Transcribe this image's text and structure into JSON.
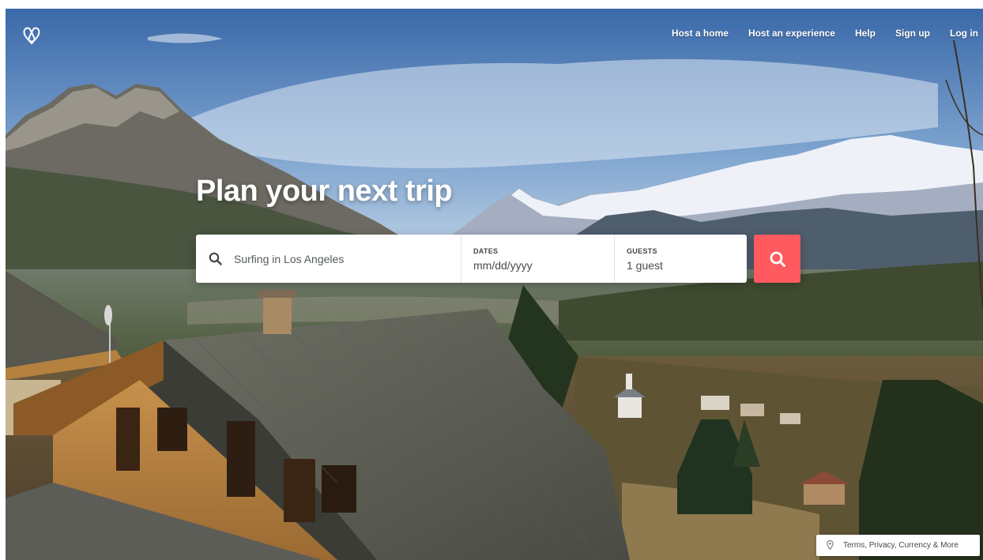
{
  "nav": {
    "logo_icon": "airbnb-belo-logo",
    "links": [
      "Host a home",
      "Host an experience",
      "Help",
      "Sign up",
      "Log in"
    ]
  },
  "hero": {
    "title": "Plan your next trip"
  },
  "search": {
    "icon": "search-icon",
    "where_value": "Surfing in Los Angeles",
    "dates_label": "DATES",
    "dates_value": "mm/dd/yyyy",
    "guests_label": "GUESTS",
    "guests_value": "1 guest",
    "button_icon": "search-icon"
  },
  "footer": {
    "icon": "map-pin-icon",
    "link": "Terms, Privacy, Currency & More"
  },
  "colors": {
    "accent": "#ff5a5f",
    "text": "#484848",
    "white": "#ffffff"
  }
}
